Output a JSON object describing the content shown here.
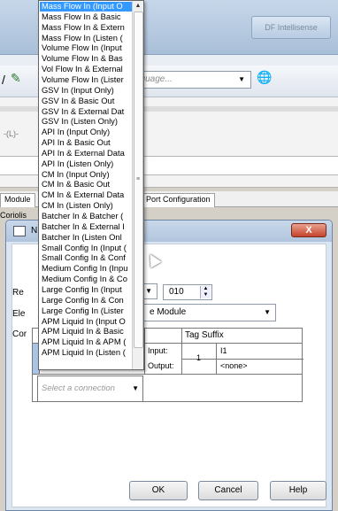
{
  "background": {
    "title_right": "DF Intellisense",
    "language_placeholder": "nguage...",
    "node_label": "-(L)-",
    "tabs": [
      "Module",
      "Port Configuration"
    ],
    "coriolis_label": "Coriolis"
  },
  "dialog": {
    "close_label": "X",
    "title": "N",
    "revision_label": "Re",
    "revision_value": "010",
    "electronic_label": "Ele",
    "electronic_value": "e Module",
    "connection_label": "Cor",
    "table": {
      "tag_suffix_header": "Tag Suffix",
      "rows": [
        {
          "label": "Input:",
          "rpi": "1",
          "value": "I1"
        },
        {
          "label": "Output:",
          "rpi": "",
          "value": "<none>"
        }
      ]
    },
    "select_connection_placeholder": "Select a connection",
    "buttons": {
      "ok": "OK",
      "cancel": "Cancel",
      "help": "Help"
    }
  },
  "dropdown": {
    "selected_index": 0,
    "items": [
      "Mass Flow In (Input O",
      "Mass Flow In & Basic",
      "Mass Flow In & Extern",
      "Mass Flow In (Listen (",
      "Volume Flow In (Input",
      "Volume Flow In & Bas",
      "Vol Flow In & External",
      "Volume Flow In (Lister",
      "GSV In (Input Only)",
      "GSV In & Basic Out",
      "GSV In & External Dat",
      "GSV In (Listen Only)",
      "API In (Input Only)",
      "API In & Basic Out",
      "API In & External Data",
      "API In (Listen Only)",
      "CM In (Input Only)",
      "CM In & Basic Out",
      "CM In & External Data",
      "CM In (Listen Only)",
      "Batcher In & Batcher (",
      "Batcher In & External I",
      "Batcher In (Listen Onl",
      "Small Config In (Input (",
      "Small Config In & Conf",
      "Medium Config In (Inpu",
      "Medium Config In & Co",
      "Large Config In (Input",
      "Large Config In & Con",
      "Large Config In (Lister",
      "APM Liquid In (Input O",
      "APM Liquid In & Basic",
      "APM Liquid In & APM (",
      "APM Liquid In (Listen ("
    ]
  }
}
